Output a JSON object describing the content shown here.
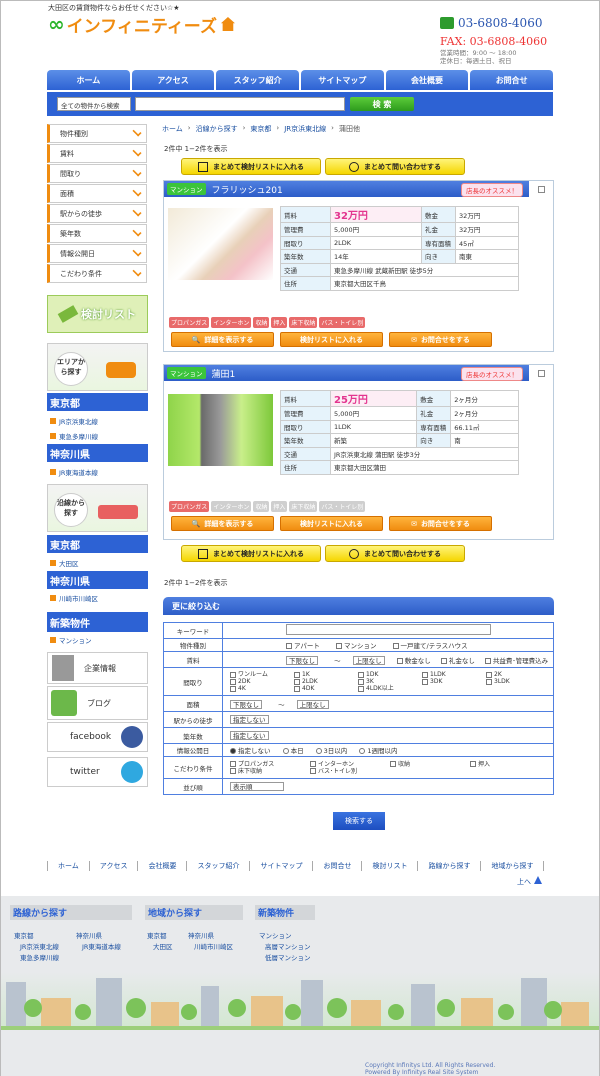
{
  "header": {
    "tagline": "大田区の賃貸物件ならお任せください☆★",
    "logo_symbol": "∞",
    "logo_name": "インフィニティーズ",
    "tel": "03-6808-4060",
    "fax": "FAX: 03-6808-4060",
    "hours": "営業時間：9:00 ～ 18:00",
    "holidays": "定休日：毎週土日、祝日"
  },
  "nav": [
    "ホーム",
    "アクセス",
    "スタッフ紹介",
    "サイトマップ",
    "会社概要",
    "お問合せ"
  ],
  "search": {
    "select": "全ての物件から検索",
    "button": "検 索"
  },
  "sidebar": {
    "categories": [
      "物件種別",
      "賃料",
      "間取り",
      "面積",
      "駅からの徒歩",
      "築年数",
      "情報公開日",
      "こだわり条件"
    ],
    "kento": "検討リスト",
    "area_title": "エリアから探す",
    "area_prefs": [
      {
        "name": "東京都",
        "links": [
          "JR京浜東北線",
          "東急多摩川線"
        ]
      },
      {
        "name": "神奈川県",
        "links": [
          "JR東海道本線"
        ]
      }
    ],
    "line_title": "沿線から探す",
    "line_prefs": [
      {
        "name": "東京都",
        "links": [
          "大田区"
        ]
      },
      {
        "name": "神奈川県",
        "links": [
          "川崎市川崎区"
        ]
      }
    ],
    "new_title": "新築物件",
    "new_links": [
      "マンション"
    ],
    "company": "企業情報",
    "blog": "ブログ",
    "facebook": "facebook",
    "twitter": "twitter"
  },
  "breadcrumb": [
    "ホーム",
    "沿線から探す",
    "東京都",
    "JR京浜東北線",
    "蒲田他"
  ],
  "count": "2件中  1−2件を表示",
  "bulk": {
    "add": "まとめて検討リストに入れる",
    "inquire": "まとめて問い合わせする"
  },
  "properties": [
    {
      "type": "マンション",
      "name": "フラリッシュ201",
      "badge": "店長のオススメ！",
      "rent": "32万円",
      "deposit_label": "敷金",
      "deposit": "32万円",
      "mgmt": "5,000円",
      "key_label": "礼金",
      "key": "32万円",
      "layout": "2LDK",
      "area_label": "専有面積",
      "area": "45㎡",
      "age": "14年",
      "dir_label": "向き",
      "dir": "南東",
      "transit": "東急多摩川線 武蔵新田駅 徒歩5分",
      "address": "東京都大田区千鳥",
      "tags": [
        "プロパンガス",
        "インターホン",
        "収納",
        "押入",
        "床下収納",
        "バス・トイレ別"
      ]
    },
    {
      "type": "マンション",
      "name": "蒲田1",
      "badge": "店長のオススメ！",
      "rent": "25万円",
      "deposit_label": "敷金",
      "deposit": "2ヶ月分",
      "mgmt": "5,000円",
      "key_label": "礼金",
      "key": "2ヶ月分",
      "layout": "1LDK",
      "area_label": "専有面積",
      "area": "66.11㎡",
      "age": "新築",
      "dir_label": "向き",
      "dir": "南",
      "transit": "JR京浜東北線 蒲田駅 徒歩3分",
      "address": "東京都大田区蒲田",
      "tags": [
        "プロパンガス",
        "インターホン",
        "収納",
        "押入",
        "床下収納",
        "バス・トイレ別"
      ]
    }
  ],
  "spec_labels": {
    "rent": "賃料",
    "mgmt": "管理費",
    "layout": "間取り",
    "age": "築年数",
    "transit": "交通",
    "address": "住所"
  },
  "prop_buttons": {
    "detail": "詳細を表示する",
    "list": "検討リストに入れる",
    "contact": "お問合せをする"
  },
  "refine": {
    "title": "更に絞り込む",
    "rows": {
      "keyword": "キーワード",
      "type": "物件種別",
      "rent": "賃料",
      "layout": "間取り",
      "area": "面積",
      "walk": "駅からの徒歩",
      "age": "築年数",
      "pub": "情報公開日",
      "kodawari": "こだわり条件",
      "sort": "並び順"
    },
    "types": [
      "アパート",
      "マンション",
      "一戸建て/テラスハウス"
    ],
    "rent_min": "下限なし",
    "rent_tilde": "〜",
    "rent_max": "上限なし",
    "rent_opts": [
      "敷金なし",
      "礼金なし",
      "共益費･管理費込み"
    ],
    "layouts": [
      "ワンルーム",
      "1K",
      "1DK",
      "1LDK",
      "2K",
      "2DK",
      "2LDK",
      "3K",
      "3DK",
      "3LDK",
      "4K",
      "4DK",
      "4LDK以上"
    ],
    "area_min": "下限なし",
    "area_tilde": "〜",
    "area_max": "上限なし",
    "walk_v": "指定しない",
    "age_v": "指定しない",
    "pub_opts": [
      "指定しない",
      "本日",
      "3日以内",
      "1週間以内"
    ],
    "kodawari_opts": [
      "プロパンガス",
      "インターホン",
      "収納",
      "押入",
      "床下収納",
      "バス･トイレ別"
    ],
    "sort_v": "表示順",
    "button": "検索する"
  },
  "footer_nav": [
    "ホーム",
    "アクセス",
    "会社概要",
    "スタッフ紹介",
    "サイトマップ",
    "お問合せ",
    "検討リスト",
    "路線から探す",
    "地域から探す"
  ],
  "to_top": "上へ",
  "footer": {
    "rosen": "路線から探す",
    "rosen_pref1": "東京都",
    "rosen_pref2": "神奈川県",
    "rosen_l1": "JR京浜東北線",
    "rosen_l2": "東急多摩川線",
    "rosen_l3": "JR東海道本線",
    "chiiki": "地域から探す",
    "chiiki_pref1": "東京都",
    "chiiki_pref2": "神奈川県",
    "chiiki_l1": "大田区",
    "chiiki_l2": "川崎市川崎区",
    "shinchiku": "新築物件",
    "shin_l1": "マンション",
    "shin_l2": "高層マンション",
    "shin_l3": "低層マンション"
  },
  "copyright": [
    "Copyright Infinitys Ltd. All Rights Reserved.",
    "Powered By Infinitys Real Site System"
  ]
}
